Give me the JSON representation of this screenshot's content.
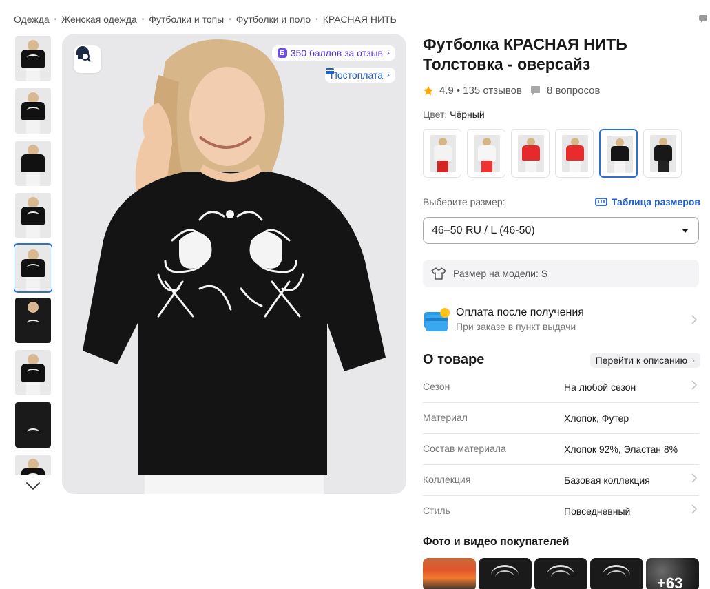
{
  "breadcrumb": [
    "Одежда",
    "Женская одежда",
    "Футболки и топы",
    "Футболки и поло",
    "КРАСНАЯ НИТЬ"
  ],
  "gallery": {
    "points_badge_icon": "Б",
    "points_label": "350 баллов за отзыв",
    "postpay_label": "Постоплата"
  },
  "product": {
    "title": "Футболка КРАСНАЯ НИТЬ Толстовка - оверсайз",
    "rating": "4.9",
    "reviews": "135 отзывов",
    "questions": "8 вопросов",
    "color_label": "Цвет:",
    "color_value": "Чёрный"
  },
  "size": {
    "label": "Выберите размер:",
    "table_link": "Таблица размеров",
    "selected": "46–50 RU / L (46-50)",
    "model_size": "Размер на модели: S"
  },
  "payment": {
    "title": "Оплата после получения",
    "subtitle": "При заказе в пункт выдачи"
  },
  "about": {
    "title": "О товаре",
    "to_description": "Перейти к описанию",
    "specs": [
      {
        "key": "Сезон",
        "value": "На любой сезон"
      },
      {
        "key": "Материал",
        "value": "Хлопок, Футер"
      },
      {
        "key": "Состав материала",
        "value": "Хлопок 92%, Эластан 8%"
      },
      {
        "key": "Коллекция",
        "value": "Базовая коллекция"
      },
      {
        "key": "Стиль",
        "value": "Повседневный"
      }
    ]
  },
  "buyer_photos": {
    "title": "Фото и видео покупателей",
    "more": "+63"
  },
  "colors": {
    "accent": "#2e6fd6",
    "link": "#1f5fcf",
    "points": "#5a32c8",
    "star": "#ffa800"
  }
}
